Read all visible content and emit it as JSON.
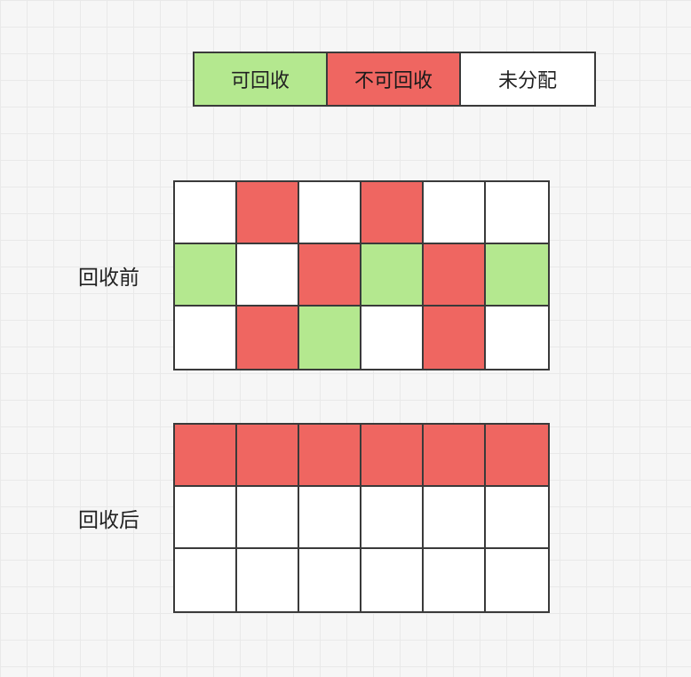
{
  "legend": {
    "recyclable": "可回收",
    "nonrecyclable": "不可回收",
    "unallocated": "未分配"
  },
  "sections": {
    "before": {
      "label": "回收前",
      "grid": [
        [
          "white",
          "red",
          "white",
          "red",
          "white",
          "white"
        ],
        [
          "green",
          "white",
          "red",
          "green",
          "red",
          "green"
        ],
        [
          "white",
          "red",
          "green",
          "white",
          "red",
          "white"
        ]
      ]
    },
    "after": {
      "label": "回收后",
      "grid": [
        [
          "red",
          "red",
          "red",
          "red",
          "red",
          "red"
        ],
        [
          "white",
          "white",
          "white",
          "white",
          "white",
          "white"
        ],
        [
          "white",
          "white",
          "white",
          "white",
          "white",
          "white"
        ]
      ]
    }
  },
  "colors": {
    "green": "#b4e88f",
    "red": "#ef6661",
    "white": "#ffffff",
    "border": "#3a3a3a",
    "bg": "#f6f6f6"
  }
}
